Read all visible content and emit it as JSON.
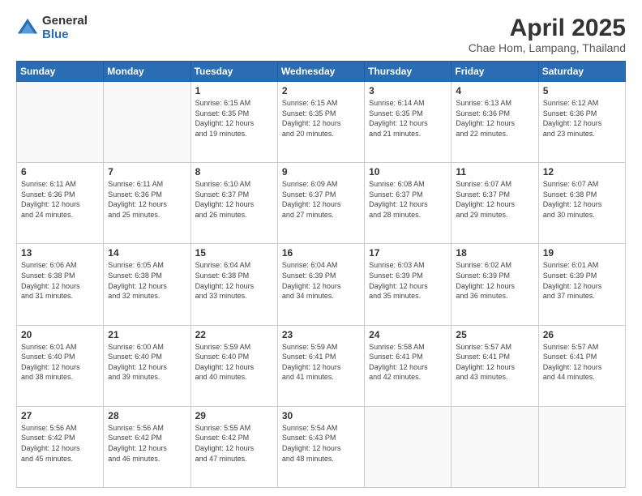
{
  "header": {
    "logo_general": "General",
    "logo_blue": "Blue",
    "main_title": "April 2025",
    "sub_title": "Chae Hom, Lampang, Thailand"
  },
  "calendar": {
    "days_of_week": [
      "Sunday",
      "Monday",
      "Tuesday",
      "Wednesday",
      "Thursday",
      "Friday",
      "Saturday"
    ],
    "weeks": [
      [
        {
          "day": "",
          "info": ""
        },
        {
          "day": "",
          "info": ""
        },
        {
          "day": "1",
          "info": "Sunrise: 6:15 AM\nSunset: 6:35 PM\nDaylight: 12 hours\nand 19 minutes."
        },
        {
          "day": "2",
          "info": "Sunrise: 6:15 AM\nSunset: 6:35 PM\nDaylight: 12 hours\nand 20 minutes."
        },
        {
          "day": "3",
          "info": "Sunrise: 6:14 AM\nSunset: 6:35 PM\nDaylight: 12 hours\nand 21 minutes."
        },
        {
          "day": "4",
          "info": "Sunrise: 6:13 AM\nSunset: 6:36 PM\nDaylight: 12 hours\nand 22 minutes."
        },
        {
          "day": "5",
          "info": "Sunrise: 6:12 AM\nSunset: 6:36 PM\nDaylight: 12 hours\nand 23 minutes."
        }
      ],
      [
        {
          "day": "6",
          "info": "Sunrise: 6:11 AM\nSunset: 6:36 PM\nDaylight: 12 hours\nand 24 minutes."
        },
        {
          "day": "7",
          "info": "Sunrise: 6:11 AM\nSunset: 6:36 PM\nDaylight: 12 hours\nand 25 minutes."
        },
        {
          "day": "8",
          "info": "Sunrise: 6:10 AM\nSunset: 6:37 PM\nDaylight: 12 hours\nand 26 minutes."
        },
        {
          "day": "9",
          "info": "Sunrise: 6:09 AM\nSunset: 6:37 PM\nDaylight: 12 hours\nand 27 minutes."
        },
        {
          "day": "10",
          "info": "Sunrise: 6:08 AM\nSunset: 6:37 PM\nDaylight: 12 hours\nand 28 minutes."
        },
        {
          "day": "11",
          "info": "Sunrise: 6:07 AM\nSunset: 6:37 PM\nDaylight: 12 hours\nand 29 minutes."
        },
        {
          "day": "12",
          "info": "Sunrise: 6:07 AM\nSunset: 6:38 PM\nDaylight: 12 hours\nand 30 minutes."
        }
      ],
      [
        {
          "day": "13",
          "info": "Sunrise: 6:06 AM\nSunset: 6:38 PM\nDaylight: 12 hours\nand 31 minutes."
        },
        {
          "day": "14",
          "info": "Sunrise: 6:05 AM\nSunset: 6:38 PM\nDaylight: 12 hours\nand 32 minutes."
        },
        {
          "day": "15",
          "info": "Sunrise: 6:04 AM\nSunset: 6:38 PM\nDaylight: 12 hours\nand 33 minutes."
        },
        {
          "day": "16",
          "info": "Sunrise: 6:04 AM\nSunset: 6:39 PM\nDaylight: 12 hours\nand 34 minutes."
        },
        {
          "day": "17",
          "info": "Sunrise: 6:03 AM\nSunset: 6:39 PM\nDaylight: 12 hours\nand 35 minutes."
        },
        {
          "day": "18",
          "info": "Sunrise: 6:02 AM\nSunset: 6:39 PM\nDaylight: 12 hours\nand 36 minutes."
        },
        {
          "day": "19",
          "info": "Sunrise: 6:01 AM\nSunset: 6:39 PM\nDaylight: 12 hours\nand 37 minutes."
        }
      ],
      [
        {
          "day": "20",
          "info": "Sunrise: 6:01 AM\nSunset: 6:40 PM\nDaylight: 12 hours\nand 38 minutes."
        },
        {
          "day": "21",
          "info": "Sunrise: 6:00 AM\nSunset: 6:40 PM\nDaylight: 12 hours\nand 39 minutes."
        },
        {
          "day": "22",
          "info": "Sunrise: 5:59 AM\nSunset: 6:40 PM\nDaylight: 12 hours\nand 40 minutes."
        },
        {
          "day": "23",
          "info": "Sunrise: 5:59 AM\nSunset: 6:41 PM\nDaylight: 12 hours\nand 41 minutes."
        },
        {
          "day": "24",
          "info": "Sunrise: 5:58 AM\nSunset: 6:41 PM\nDaylight: 12 hours\nand 42 minutes."
        },
        {
          "day": "25",
          "info": "Sunrise: 5:57 AM\nSunset: 6:41 PM\nDaylight: 12 hours\nand 43 minutes."
        },
        {
          "day": "26",
          "info": "Sunrise: 5:57 AM\nSunset: 6:41 PM\nDaylight: 12 hours\nand 44 minutes."
        }
      ],
      [
        {
          "day": "27",
          "info": "Sunrise: 5:56 AM\nSunset: 6:42 PM\nDaylight: 12 hours\nand 45 minutes."
        },
        {
          "day": "28",
          "info": "Sunrise: 5:56 AM\nSunset: 6:42 PM\nDaylight: 12 hours\nand 46 minutes."
        },
        {
          "day": "29",
          "info": "Sunrise: 5:55 AM\nSunset: 6:42 PM\nDaylight: 12 hours\nand 47 minutes."
        },
        {
          "day": "30",
          "info": "Sunrise: 5:54 AM\nSunset: 6:43 PM\nDaylight: 12 hours\nand 48 minutes."
        },
        {
          "day": "",
          "info": ""
        },
        {
          "day": "",
          "info": ""
        },
        {
          "day": "",
          "info": ""
        }
      ]
    ]
  }
}
